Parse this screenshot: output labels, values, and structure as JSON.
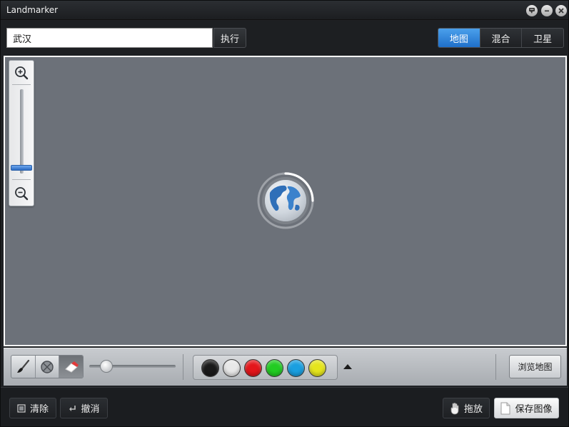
{
  "window": {
    "title": "Landmarker",
    "controls": [
      "feedback-icon",
      "minimize-icon",
      "close-icon"
    ]
  },
  "search": {
    "value": "武汉",
    "execute_label": "执行"
  },
  "map_types": {
    "items": [
      {
        "label": "地图",
        "active": true
      },
      {
        "label": "混合",
        "active": false
      },
      {
        "label": "卫星",
        "active": false
      }
    ]
  },
  "map": {
    "background_color": "#6c7179",
    "zoom_level": 0.04,
    "zoom_in_icon": "zoom-in-icon",
    "zoom_out_icon": "zoom-out-icon",
    "loading_icon": "globe-loading-icon"
  },
  "draw_toolbar": {
    "tools": [
      {
        "icon": "brush-icon",
        "active": false
      },
      {
        "icon": "no-fill-icon",
        "active": false
      },
      {
        "icon": "eraser-icon",
        "active": true
      }
    ],
    "brush_size": 0.15,
    "colors": [
      "#1a1a1a",
      "#e8e8e8",
      "#e3161b",
      "#22cc22",
      "#1a9fe0",
      "#e5e51c"
    ],
    "more_colors_icon": "triangle-up-icon",
    "browse_label": "浏览地图"
  },
  "bottom": {
    "clear_label": "清除",
    "undo_label": "撤消",
    "drag_label": "拖放",
    "save_label": "保存图像"
  }
}
